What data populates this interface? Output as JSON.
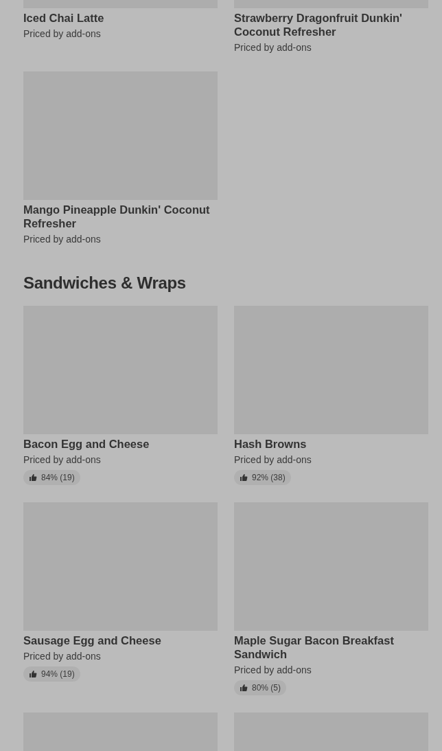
{
  "sections": [
    {
      "items": [
        {
          "kind": "product",
          "name": "Iced Chai Latte",
          "price": "Priced by add-ons"
        },
        {
          "kind": "product",
          "name": "Strawberry Dragonfruit Dunkin' Coconut Refresher",
          "price": "Priced by add-ons"
        },
        {
          "kind": "product",
          "name": "Mango Pineapple Dunkin' Coconut Refresher",
          "price": "Priced by add-ons"
        }
      ]
    },
    {
      "title": "Sandwiches & Wraps",
      "items": [
        {
          "kind": "product",
          "name": "Bacon Egg and Cheese",
          "price": "Priced by add-ons",
          "rating": "84% (19)"
        },
        {
          "kind": "product",
          "name": "Hash Browns",
          "price": "Priced by add-ons",
          "rating": "92% (38)"
        },
        {
          "kind": "product",
          "name": "Sausage Egg and Cheese",
          "price": "Priced by add-ons",
          "rating": "94% (19)"
        },
        {
          "kind": "product",
          "name": "Maple Sugar Bacon Breakfast Sandwich",
          "price": "Priced by add-ons",
          "rating": "80% (5)"
        },
        {
          "kind": "product"
        },
        {
          "kind": "product"
        }
      ]
    }
  ]
}
